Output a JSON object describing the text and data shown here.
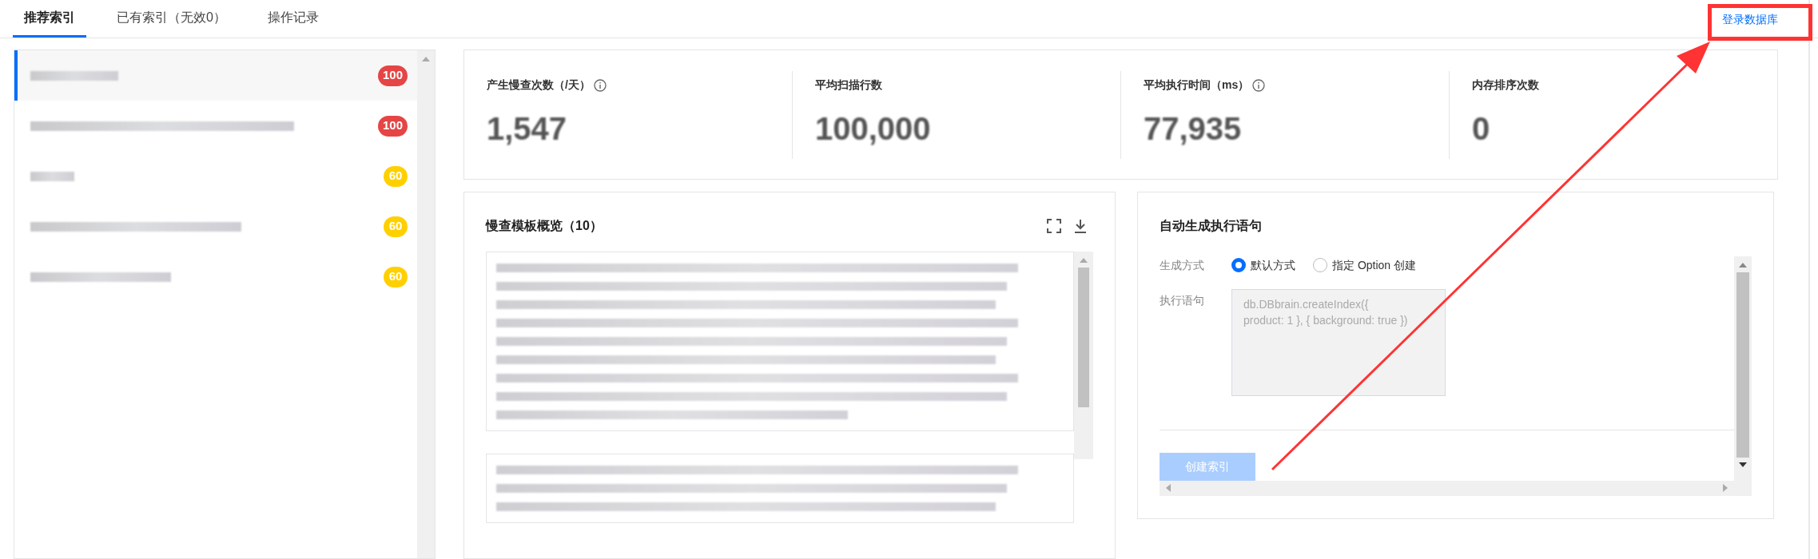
{
  "tabs": [
    {
      "label": "推荐索引",
      "selected": true
    },
    {
      "label": "已有索引（无效0）",
      "selected": false
    },
    {
      "label": "操作记录",
      "selected": false
    }
  ],
  "login_link": "登录数据库",
  "sidebar": {
    "items": [
      {
        "badge": "100",
        "color": "#e54545",
        "selected": true
      },
      {
        "badge": "100",
        "color": "#e54545",
        "selected": false
      },
      {
        "badge": "60",
        "color": "#ffd000",
        "selected": false
      },
      {
        "badge": "60",
        "color": "#ffd000",
        "selected": false
      },
      {
        "badge": "60",
        "color": "#ffd000",
        "selected": false
      }
    ]
  },
  "stats": [
    {
      "label": "产生慢查次数（/天）",
      "info": true,
      "value": "1,547"
    },
    {
      "label": "平均扫描行数",
      "info": false,
      "value": "100,000"
    },
    {
      "label": "平均执行时间（ms）",
      "info": true,
      "value": "77,935"
    },
    {
      "label": "内存排序次数",
      "info": false,
      "value": "0"
    }
  ],
  "slow_query_panel": {
    "title": "慢查模板概览（10）"
  },
  "generate_panel": {
    "title": "自动生成执行语句",
    "mode_label": "生成方式",
    "options": [
      {
        "label": "默认方式",
        "selected": true
      },
      {
        "label": "指定 Option 创建",
        "selected": false
      }
    ],
    "statement_label": "执行语句",
    "statement": "db.DBbrain.createIndex({\nproduct: 1 }, { background: true })",
    "button": {
      "label": "创建索引",
      "disabled": true
    }
  }
}
